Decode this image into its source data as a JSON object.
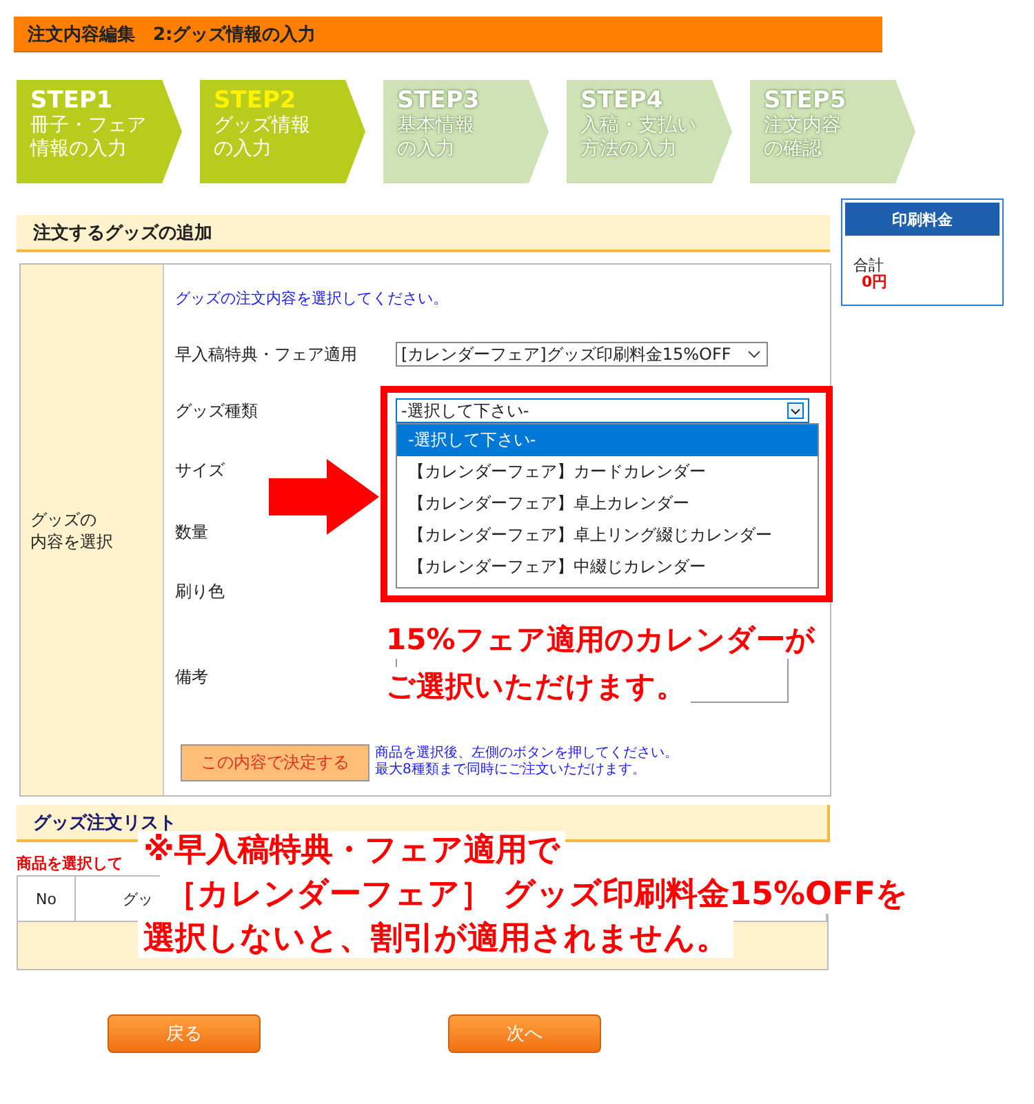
{
  "header": {
    "title": "注文内容編集　2:グッズ情報の入力"
  },
  "steps": [
    {
      "label": "STEP1",
      "lines": [
        "冊子・フェア",
        "情報の入力"
      ],
      "done": true,
      "selected": false
    },
    {
      "label": "STEP2",
      "lines": [
        "グッズ情報",
        "の入力"
      ],
      "done": false,
      "selected": true
    },
    {
      "label": "STEP3",
      "lines": [
        "基本情報",
        "の入力"
      ],
      "done": false,
      "selected": false
    },
    {
      "label": "STEP4",
      "lines": [
        "入稿・支払い",
        "方法の入力"
      ],
      "done": false,
      "selected": false
    },
    {
      "label": "STEP5",
      "lines": [
        "注文内容",
        "の確認"
      ],
      "done": false,
      "selected": false
    }
  ],
  "price_box": {
    "title": "印刷料金",
    "total_label": "合計",
    "total": "0円"
  },
  "add_section": {
    "title": "注文するグッズの追加",
    "side_label": [
      "グッズの",
      "内容を選択"
    ],
    "instruction": "グッズの注文内容を選択してください。",
    "fields": [
      {
        "label": "早入稿特典・フェア適用",
        "kind": "select",
        "value": "[カレンダーフェア]グッズ印刷料金15%OFF"
      },
      {
        "label": "グッズ種類",
        "kind": "dropdown",
        "value": "-選択して下さい-",
        "options": [
          {
            "text": "-選択して下さい-",
            "selected": true
          },
          {
            "text": "【カレンダーフェア】カードカレンダー",
            "selected": false
          },
          {
            "text": "【カレンダーフェア】卓上カレンダー",
            "selected": false
          },
          {
            "text": "【カレンダーフェア】卓上リング綴じカレンダー",
            "selected": false
          },
          {
            "text": "【カレンダーフェア】中綴じカレンダー",
            "selected": false
          }
        ]
      },
      {
        "label": "サイズ",
        "kind": "hidden"
      },
      {
        "label": "数量",
        "kind": "hidden"
      },
      {
        "label": "刷り色",
        "kind": "hidden"
      },
      {
        "label": "備考",
        "kind": "textarea"
      }
    ],
    "submit": "この内容で決定する",
    "note": [
      "商品を選択後、左側のボタンを押してください。",
      "最大8種類まで同時にご注文いただけます。"
    ]
  },
  "order_list": {
    "title": "グッズ注文リスト",
    "warning": "商品を選択して",
    "columns": [
      "No",
      "グッ"
    ]
  },
  "buttons": [
    {
      "label": "戻る"
    },
    {
      "label": "次へ"
    }
  ],
  "callout": [
    "15%フェア適用のカレンダーが",
    "ご選択いただけます。"
  ],
  "notice": [
    "※早入稿特典・フェア適用で",
    "［カレンダーフェア］ グッズ印刷料金15%OFFを",
    "選択しないと、割引が適用されません。"
  ]
}
